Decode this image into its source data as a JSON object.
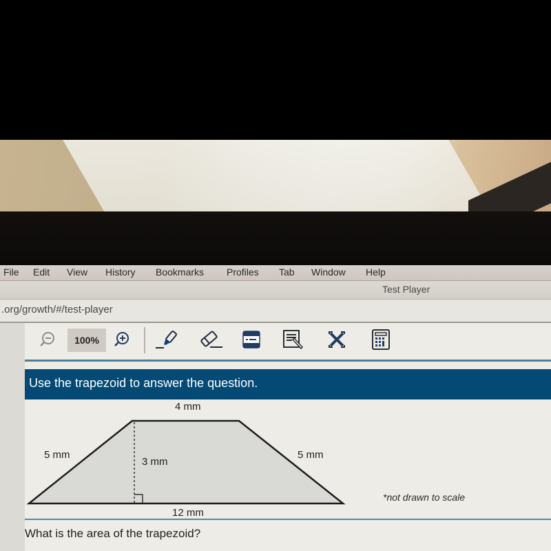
{
  "browser": {
    "menu": [
      "File",
      "Edit",
      "View",
      "History",
      "Bookmarks",
      "Profiles",
      "Tab",
      "Window",
      "Help"
    ],
    "window_title": "Test Player",
    "url": ".org/growth/#/test-player"
  },
  "toolbar": {
    "zoom_level": "100%",
    "tools": [
      {
        "name": "zoom-out",
        "icon": "zoom-out-icon"
      },
      {
        "name": "zoom-in",
        "icon": "zoom-in-icon"
      },
      {
        "name": "highlighter",
        "icon": "highlighter-icon"
      },
      {
        "name": "eraser",
        "icon": "eraser-icon"
      },
      {
        "name": "line-reader",
        "icon": "line-reader-icon"
      },
      {
        "name": "notepad",
        "icon": "notepad-icon"
      },
      {
        "name": "answer-eliminator",
        "icon": "eliminate-icon"
      },
      {
        "name": "calculator",
        "icon": "calculator-icon"
      }
    ],
    "accent_color": "#1f3c64"
  },
  "question": {
    "instruction": "Use the trapezoid to answer the question.",
    "figure": {
      "top_base": "4 mm",
      "bottom_base": "12 mm",
      "left_side": "5 mm",
      "right_side": "5 mm",
      "height": "3 mm",
      "note": "*not drawn to scale"
    },
    "prompt": "What is the area of the trapezoid?"
  },
  "colors": {
    "banner": "#044a74",
    "rule": "#4b7f96",
    "shape_fill": "#d9dad6"
  }
}
